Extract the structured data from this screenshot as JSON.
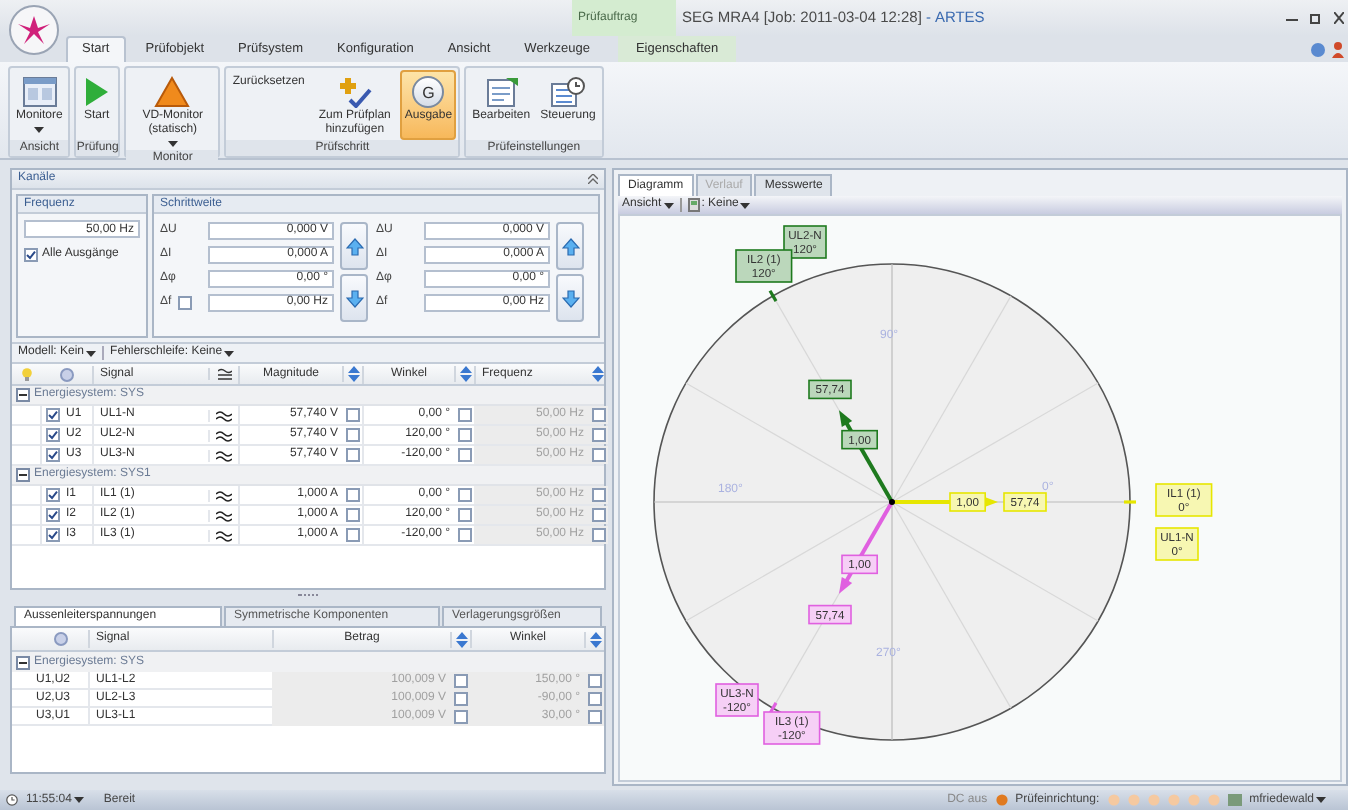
{
  "title_bar": {
    "context_tab": "Prüfauftrag",
    "title": "SEG MRA4 [Job: 2011-03-04 12:28]",
    "dash": "-",
    "product": "ARTES"
  },
  "menu_tabs": [
    {
      "label": "Start",
      "selected": true,
      "contextual": false
    },
    {
      "label": "Prüfobjekt",
      "selected": false,
      "contextual": false
    },
    {
      "label": "Prüfsystem",
      "selected": false,
      "contextual": false
    },
    {
      "label": "Konfiguration",
      "selected": false,
      "contextual": false
    },
    {
      "label": "Ansicht",
      "selected": false,
      "contextual": false
    },
    {
      "label": "Werkzeuge",
      "selected": false,
      "contextual": false
    },
    {
      "label": "Eigenschaften",
      "selected": false,
      "contextual": true
    }
  ],
  "ribbon": [
    {
      "label": "Ansicht",
      "buttons": [
        {
          "label": "Monitore",
          "kind": "monitor",
          "dropdown": true,
          "selected": false
        }
      ]
    },
    {
      "label": "Prüfung",
      "buttons": [
        {
          "label": "Start",
          "kind": "play",
          "dropdown": false,
          "selected": false
        }
      ]
    },
    {
      "label": "Monitor",
      "buttons": [
        {
          "label": "VD-Monitor (statisch)",
          "kind": "warning",
          "dropdown": true,
          "selected": false
        }
      ]
    },
    {
      "label": "Prüfschritt",
      "buttons": [
        {
          "label": "Zurücksetzen",
          "kind": "text",
          "dropdown": false,
          "selected": false
        },
        {
          "label": "Zum Prüfplan hinzufügen",
          "kind": "add",
          "dropdown": false,
          "selected": false
        },
        {
          "label": "Ausgabe",
          "kind": "badge",
          "badge": "G",
          "dropdown": false,
          "selected": true
        }
      ]
    },
    {
      "label": "Prüfeinstellungen",
      "buttons": [
        {
          "label": "Bearbeiten",
          "kind": "edit",
          "dropdown": false,
          "selected": false
        },
        {
          "label": "Steuerung",
          "kind": "control",
          "dropdown": false,
          "selected": false
        }
      ]
    }
  ],
  "channels": {
    "title": "Kanäle",
    "frequency": {
      "title": "Frequenz",
      "value": "50,00 Hz",
      "all_outputs": {
        "label": "Alle Ausgänge",
        "checked": true
      }
    },
    "step": {
      "title": "Schrittweite",
      "columns": [
        [
          {
            "label": "ΔU",
            "value": "0,000 V"
          },
          {
            "label": "ΔI",
            "value": "0,000 A"
          },
          {
            "label": "Δφ",
            "value": "0,00 °"
          },
          {
            "label": "Δf",
            "value": "0,00 Hz",
            "checkbox": {
              "checked": false
            }
          }
        ],
        [
          {
            "label": "ΔU",
            "value": "0,000 V"
          },
          {
            "label": "ΔI",
            "value": "0,000 A"
          },
          {
            "label": "Δφ",
            "value": "0,00 °"
          },
          {
            "label": "Δf",
            "value": "0,00 Hz"
          }
        ]
      ]
    },
    "toolbar": [
      "Modell: Kein",
      "Fehlerschleife: Keine"
    ],
    "table": {
      "columns": [
        "Signal",
        "Magnitude",
        "Winkel",
        "Frequenz"
      ],
      "groups": [
        {
          "label": "Energiesystem: SYS",
          "expanded": true,
          "rows": [
            {
              "checked": true,
              "name": "U1",
              "signal": "UL1-N",
              "magnitude": "57,740 V",
              "magnitude_fixed": false,
              "angle": "0,00 °",
              "angle_fixed": false,
              "frequency": "50,00 Hz",
              "frequency_fixed": false
            },
            {
              "checked": true,
              "name": "U2",
              "signal": "UL2-N",
              "magnitude": "57,740 V",
              "magnitude_fixed": false,
              "angle": "120,00 °",
              "angle_fixed": false,
              "frequency": "50,00 Hz",
              "frequency_fixed": false
            },
            {
              "checked": true,
              "name": "U3",
              "signal": "UL3-N",
              "magnitude": "57,740 V",
              "magnitude_fixed": false,
              "angle": "-120,00 °",
              "angle_fixed": false,
              "frequency": "50,00 Hz",
              "frequency_fixed": false
            }
          ]
        },
        {
          "label": "Energiesystem: SYS1",
          "expanded": true,
          "rows": [
            {
              "checked": true,
              "name": "I1",
              "signal": "IL1 (1)",
              "magnitude": "1,000 A",
              "magnitude_fixed": false,
              "angle": "0,00 °",
              "angle_fixed": false,
              "frequency": "50,00 Hz",
              "frequency_fixed": false
            },
            {
              "checked": true,
              "name": "I2",
              "signal": "IL2 (1)",
              "magnitude": "1,000 A",
              "magnitude_fixed": false,
              "angle": "120,00 °",
              "angle_fixed": false,
              "frequency": "50,00 Hz",
              "frequency_fixed": false
            },
            {
              "checked": true,
              "name": "I3",
              "signal": "IL3 (1)",
              "magnitude": "1,000 A",
              "magnitude_fixed": false,
              "angle": "-120,00 °",
              "angle_fixed": false,
              "frequency": "50,00 Hz",
              "frequency_fixed": false
            }
          ]
        }
      ]
    }
  },
  "lower": {
    "tabs": [
      {
        "label": "Aussenleiterspannungen",
        "selected": true
      },
      {
        "label": "Symmetrische Komponenten",
        "selected": false
      },
      {
        "label": "Verlagerungsgrößen",
        "selected": false
      }
    ],
    "table": {
      "columns": [
        "Signal",
        "Betrag",
        "Winkel"
      ],
      "groups": [
        {
          "label": "Energiesystem: SYS",
          "expanded": true,
          "rows": [
            {
              "name": "U1,U2",
              "signal": "UL1-L2",
              "magnitude": "100,009 V",
              "magnitude_fixed": false,
              "angle": "150,00 °",
              "angle_fixed": false
            },
            {
              "name": "U2,U3",
              "signal": "UL2-L3",
              "magnitude": "100,009 V",
              "magnitude_fixed": false,
              "angle": "-90,00 °",
              "angle_fixed": false
            },
            {
              "name": "U3,U1",
              "signal": "UL3-L1",
              "magnitude": "100,009 V",
              "magnitude_fixed": false,
              "angle": "30,00 °",
              "angle_fixed": false
            }
          ]
        }
      ]
    }
  },
  "diagram": {
    "tabs": [
      {
        "label": "Diagramm",
        "selected": true,
        "disabled": false
      },
      {
        "label": "Verlauf",
        "selected": false,
        "disabled": true
      },
      {
        "label": "Messwerte",
        "selected": false,
        "disabled": false
      }
    ],
    "toolbar": {
      "view": "Ansicht",
      "filter": ": Keine"
    },
    "axis_labels": [
      "90°",
      "180°",
      "0°",
      "270°"
    ],
    "phasors": [
      {
        "color": "#e6e600",
        "voltage": {
          "name": "UL1-N",
          "angle": "0°",
          "magnitude": "57,74"
        },
        "current": {
          "name": "IL1 (1)",
          "angle": "0°",
          "magnitude": "1,00"
        }
      },
      {
        "color": "#1e7a1e",
        "voltage": {
          "name": "UL2-N",
          "angle": "120°",
          "magnitude": "57,74"
        },
        "current": {
          "name": "IL2 (1)",
          "angle": "120°",
          "magnitude": "1,00"
        }
      },
      {
        "color": "#e060e0",
        "voltage": {
          "name": "UL3-N",
          "angle": "-120°",
          "magnitude": "57,74"
        },
        "current": {
          "name": "IL3 (1)",
          "angle": "-120°",
          "magnitude": "1,00"
        }
      }
    ]
  },
  "status_bar": {
    "time": "11:55:04",
    "state": "Bereit",
    "dc": "DC aus",
    "setup": "Prüfeinrichtung:",
    "user": "mfriedewald"
  }
}
